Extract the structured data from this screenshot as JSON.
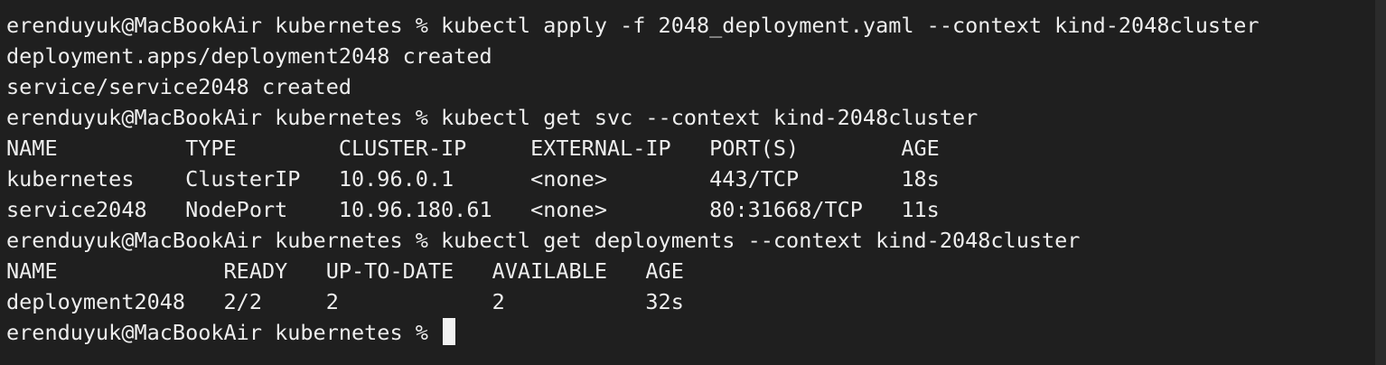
{
  "terminal": {
    "lines": [
      "erenduyuk@MacBookAir kubernetes % kubectl apply -f 2048_deployment.yaml --context kind-2048cluster",
      "deployment.apps/deployment2048 created",
      "service/service2048 created",
      "erenduyuk@MacBookAir kubernetes % kubectl get svc --context kind-2048cluster",
      "NAME          TYPE        CLUSTER-IP     EXTERNAL-IP   PORT(S)        AGE",
      "kubernetes    ClusterIP   10.96.0.1      <none>        443/TCP        18s",
      "service2048   NodePort    10.96.180.61   <none>        80:31668/TCP   11s",
      "erenduyuk@MacBookAir kubernetes % kubectl get deployments --context kind-2048cluster",
      "NAME             READY   UP-TO-DATE   AVAILABLE   AGE",
      "deployment2048   2/2     2            2           32s",
      "erenduyuk@MacBookAir kubernetes % "
    ]
  }
}
